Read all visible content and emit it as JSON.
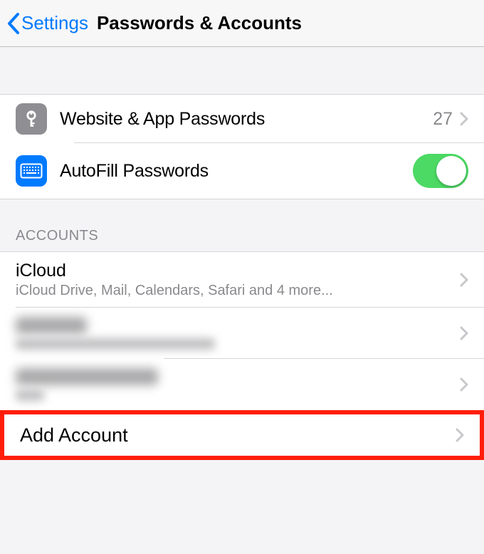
{
  "nav": {
    "back_label": "Settings",
    "title": "Passwords & Accounts"
  },
  "passwords_group": {
    "website_row": {
      "label": "Website & App Passwords",
      "count": "27"
    },
    "autofill_row": {
      "label": "AutoFill Passwords",
      "enabled": true
    }
  },
  "accounts_section": {
    "header": "ACCOUNTS",
    "items": [
      {
        "title": "iCloud",
        "subtitle": "iCloud Drive, Mail, Calendars, Safari and 4 more..."
      }
    ],
    "add_label": "Add Account"
  }
}
